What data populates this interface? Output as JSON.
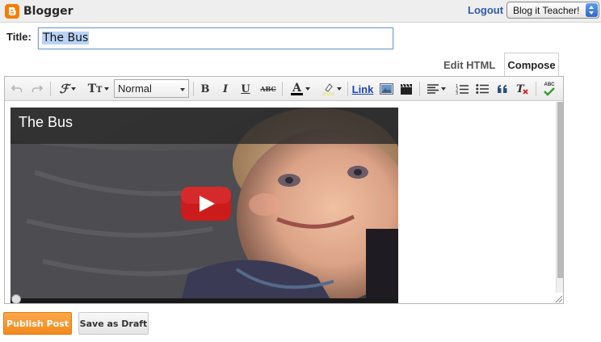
{
  "header": {
    "brand": "Blogger",
    "logout": "Logout",
    "blog_selector": "Blog it Teacher!"
  },
  "post": {
    "title_label": "Title:",
    "title_value": "The Bus"
  },
  "mode_tabs": {
    "edit_html": "Edit HTML",
    "compose": "Compose"
  },
  "toolbar": {
    "font_style": "Normal",
    "bold": "B",
    "italic": "I",
    "underline": "U",
    "strikethrough": "ABC",
    "text_color": "A",
    "link": "Link",
    "spellcheck": "ABC",
    "icons": [
      "undo-icon",
      "redo-icon",
      "font-family-icon",
      "font-size-icon",
      "bold-icon",
      "italic-icon",
      "underline-icon",
      "strikethrough-icon",
      "text-color-icon",
      "highlight-icon",
      "link-icon",
      "image-icon",
      "video-icon",
      "align-icon",
      "numbered-list-icon",
      "bullet-list-icon",
      "blockquote-icon",
      "remove-format-icon",
      "spellcheck-icon"
    ]
  },
  "embedded_video": {
    "title": "The Bus"
  },
  "actions": {
    "publish": "Publish Post",
    "save_draft": "Save as Draft"
  },
  "colors": {
    "brand_orange": "#f57d00",
    "link_blue": "#2f5aa5",
    "publish_orange": "#f38a1c"
  }
}
